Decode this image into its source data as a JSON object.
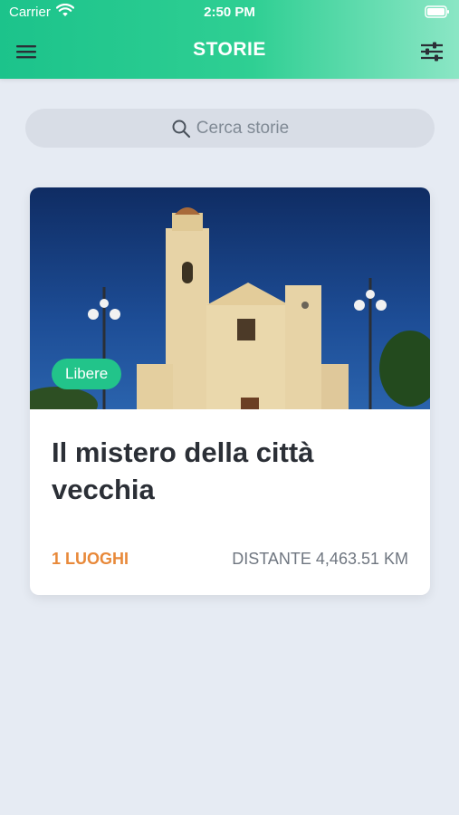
{
  "status": {
    "carrier": "Carrier",
    "time": "2:50 PM"
  },
  "nav": {
    "title": "STORIE",
    "menu_icon": "hamburger-icon",
    "filter_icon": "sliders-icon"
  },
  "search": {
    "placeholder": "Cerca storie",
    "icon": "search-icon"
  },
  "stories": [
    {
      "title": "Il mistero della città vecchia",
      "badge": "Libere",
      "places": "1 LUOGHI",
      "distance": "DISTANTE 4,463.51 KM"
    }
  ],
  "colors": {
    "header_start": "#1cc38b",
    "header_end": "#8be6c5",
    "badge": "#22c48a",
    "places": "#e8893a",
    "background": "#e6ebf3"
  }
}
